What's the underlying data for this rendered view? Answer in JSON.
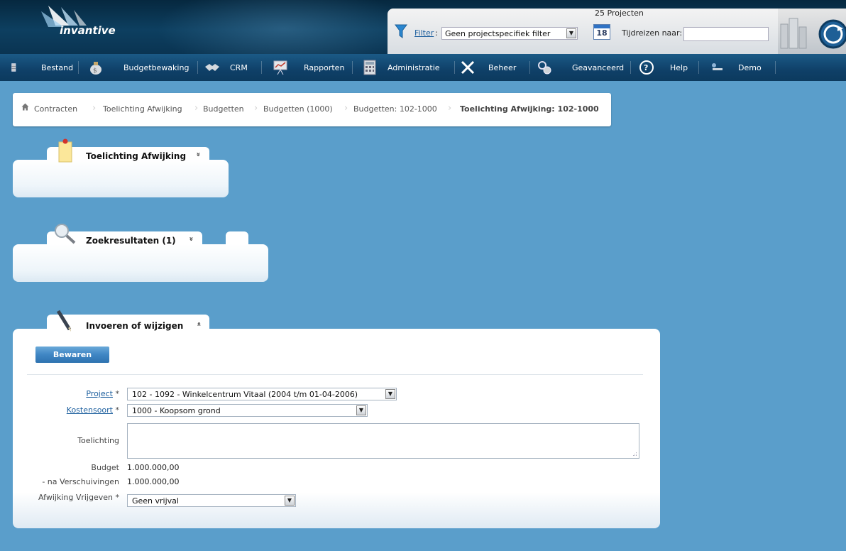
{
  "header": {
    "logo_text": "invantive",
    "project_count": "25 Projecten",
    "filter_link": "Filter",
    "filter_value": "Geen projectspecifiek filter",
    "calendar_day": "18",
    "time_travel_label": "Tijdreizen naar:",
    "time_travel_value": ""
  },
  "nav": {
    "items": [
      {
        "label": "Bestand",
        "icon": "file-cabinet-icon"
      },
      {
        "label": "Budgetbewaking",
        "icon": "money-bag-icon"
      },
      {
        "label": "CRM",
        "icon": "handshake-icon"
      },
      {
        "label": "Rapporten",
        "icon": "presentation-icon"
      },
      {
        "label": "Administratie",
        "icon": "calculator-icon"
      },
      {
        "label": "Beheer",
        "icon": "tools-icon"
      },
      {
        "label": "Geavanceerd",
        "icon": "gears-icon"
      },
      {
        "label": "Help",
        "icon": "help-icon"
      },
      {
        "label": "Demo",
        "icon": "user-icon"
      }
    ]
  },
  "breadcrumb": {
    "items": [
      "Contracten",
      "Toelichting Afwijking",
      "Budgetten",
      "Budgetten (1000)",
      "Budgetten: 102-1000",
      "Toelichting Afwijking: 102-1000"
    ]
  },
  "panels": {
    "toelichting": {
      "title": "Toelichting Afwijking",
      "toggle": "»"
    },
    "zoekresultaten": {
      "title": "Zoekresultaten (1)",
      "toggle": "»"
    },
    "invoeren": {
      "title": "Invoeren of wijzigen",
      "toggle": "«"
    }
  },
  "form": {
    "save_label": "Bewaren",
    "project_label": "Project",
    "project_value": "102 - 1092 - Winkelcentrum Vitaal (2004 t/m 01-04-2006)",
    "kostensoort_label": "Kostensoort",
    "kostensoort_value": "1000 - Koopsom grond",
    "toelichting_label": "Toelichting",
    "toelichting_value": "",
    "budget_label": "Budget",
    "budget_value": "1.000.000,00",
    "na_label": "- na Verschuivingen",
    "na_value": "1.000.000,00",
    "afwijking_label": "Afwijking Vrijgeven",
    "afwijking_value": "Geen vrijval",
    "required_mark": " *"
  },
  "colors": {
    "background": "#5a9ecb",
    "header": "#0d3f60",
    "nav": "#0f4068",
    "link": "#1d5f9e",
    "button": "#3f86c4"
  }
}
